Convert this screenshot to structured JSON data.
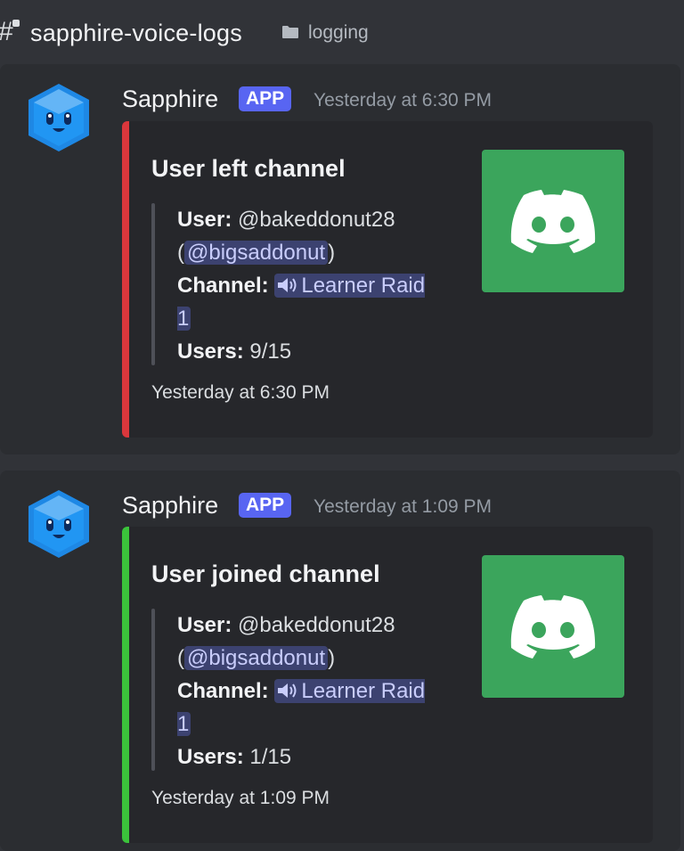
{
  "header": {
    "channel_name": "sapphire-voice-logs",
    "category": "logging",
    "channel_icon": "hash-lock-icon",
    "category_icon": "folder-icon"
  },
  "messages": [
    {
      "author": "Sapphire",
      "badge": "APP",
      "timestamp": "Yesterday at 6:30 PM",
      "embed": {
        "accent_color": "#da373c",
        "title": "User left channel",
        "user_label": "User:",
        "user_value": "@bakeddonut28",
        "paren_open": "(",
        "mention": "@bigsaddonut",
        "paren_close": ")",
        "channel_label": "Channel:",
        "channel_value": "Learner Raid 1",
        "users_label": "Users:",
        "users_value": "9/15",
        "footer": "Yesterday at 6:30 PM"
      }
    },
    {
      "author": "Sapphire",
      "badge": "APP",
      "timestamp": "Yesterday at 1:09 PM",
      "embed": {
        "accent_color": "#3ba55c",
        "title": "User joined channel",
        "user_label": "User:",
        "user_value": "@bakeddonut28",
        "paren_open": "(",
        "mention": "@bigsaddonut",
        "paren_close": ")",
        "channel_label": "Channel:",
        "channel_value": "Learner Raid 1",
        "users_label": "Users:",
        "users_value": "1/15",
        "footer": "Yesterday at 1:09 PM"
      }
    }
  ],
  "colors": {
    "background": "#313338",
    "message_bg": "#2b2d31",
    "embed_bg": "#26272b",
    "badge": "#5865f2",
    "thumbnail": "#3ba55c"
  }
}
